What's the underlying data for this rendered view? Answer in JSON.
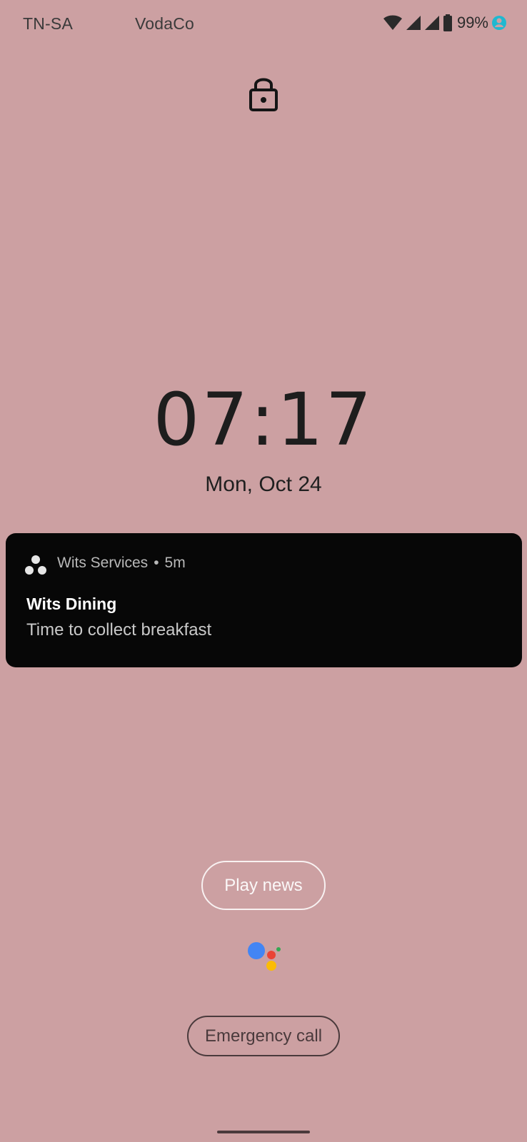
{
  "status_bar": {
    "carrier_1": "TN-SA",
    "carrier_2": "VodaCo",
    "battery_percent": "99%",
    "icons": [
      "wifi-icon",
      "signal-icon",
      "signal-icon",
      "battery-icon",
      "account-status-icon"
    ]
  },
  "lock_screen": {
    "lock_icon": "lock-icon",
    "time": "07:17",
    "date": "Mon, Oct 24"
  },
  "notification": {
    "app_icon": "wits-services-app-icon",
    "app_name": "Wits Services",
    "separator": "•",
    "age": "5m",
    "title": "Wits Dining",
    "body": "Time to collect breakfast"
  },
  "actions": {
    "play_news_label": "Play news",
    "assistant_icon": "google-assistant-icon",
    "emergency_call_label": "Emergency call"
  },
  "colors": {
    "background": "#cca0a2",
    "notification_background": "#070707",
    "assistant_blue": "#4285f4",
    "assistant_red": "#ea4335",
    "assistant_yellow": "#fbbc05",
    "assistant_green": "#34a853"
  }
}
